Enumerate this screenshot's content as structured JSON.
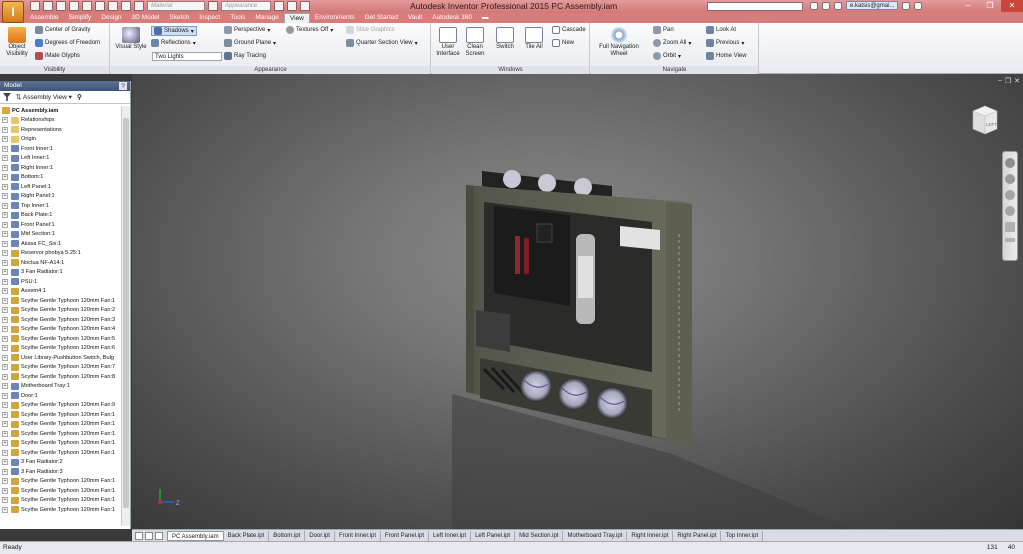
{
  "titlebar": {
    "title": "Autodesk Inventor Professional 2015   PC Assembly.iam",
    "app_button": "I",
    "material_placeholder": "Material",
    "appearance_placeholder": "Appearance",
    "user": "e.katsis@gmai...",
    "search_value": ""
  },
  "ribbon_tabs": [
    "Assemble",
    "Simplify",
    "Design",
    "3D Model",
    "Sketch",
    "Inspect",
    "Tools",
    "Manage",
    "View",
    "Environments",
    "Get Started",
    "Vault",
    "Autodesk 360"
  ],
  "active_tab": "View",
  "ribbon": {
    "visibility": {
      "title": "Visibility",
      "object_visibility": "Object\nVisibility",
      "center_of_gravity": "Center of Gravity",
      "degrees_of_freedom": "Degrees of Freedom",
      "imate_glyphs": "iMate Glyphs"
    },
    "appearance": {
      "title": "Appearance",
      "visual_style": "Visual Style",
      "shadows": "Shadows",
      "reflections": "Reflections",
      "lighting": "Two Lights",
      "perspective": "Perspective",
      "ground_plane": "Ground Plane",
      "ray_tracing": "Ray Tracing",
      "textures": "Textures Off",
      "slice_graphics": "Slice Graphics",
      "quarter_section": "Quarter Section View"
    },
    "windows": {
      "title": "Windows",
      "user_interface": "User\nInterface",
      "clean_screen": "Clean\nScreen",
      "switch": "Switch",
      "tile_all": "Tile All",
      "cascade": "Cascade",
      "new": "New"
    },
    "navigate": {
      "title": "Navigate",
      "full_navigation_wheel": "Full Navigation\nWheel",
      "pan": "Pan",
      "zoom_all": "Zoom All",
      "orbit": "Orbit",
      "look_at": "Look At",
      "previous": "Previous",
      "home_view": "Home View"
    }
  },
  "browser": {
    "header": "Model",
    "help": "?",
    "view_label": "Assembly View",
    "items": [
      {
        "label": "PC Assembly.iam",
        "icon": "assembly-icon",
        "root": true
      },
      {
        "label": "Relationships",
        "icon": "folder-icon"
      },
      {
        "label": "Representations",
        "icon": "folder-icon"
      },
      {
        "label": "Origin",
        "icon": "folder-icon"
      },
      {
        "label": "Front Inner:1",
        "icon": "part-icon"
      },
      {
        "label": "Left Inner:1",
        "icon": "part-icon"
      },
      {
        "label": "Right Inner:1",
        "icon": "part-icon"
      },
      {
        "label": "Bottom:1",
        "icon": "part-icon"
      },
      {
        "label": "Left Panel:1",
        "icon": "part-icon"
      },
      {
        "label": "Right Panel:1",
        "icon": "part-icon"
      },
      {
        "label": "Top Inner:1",
        "icon": "part-icon"
      },
      {
        "label": "Back Plate:1",
        "icon": "part-icon"
      },
      {
        "label": "Front Panel:1",
        "icon": "part-icon"
      },
      {
        "label": "Mid Section:1",
        "icon": "part-icon"
      },
      {
        "label": "Akasa FC_Six:1",
        "icon": "part-icon"
      },
      {
        "label": "Reservor phobya 5.25:1",
        "icon": "subassembly-icon"
      },
      {
        "label": "Noctua NF-A14:1",
        "icon": "subassembly-icon"
      },
      {
        "label": "3 Fan Radiator:1",
        "icon": "part-icon"
      },
      {
        "label": "PSU:1",
        "icon": "part-icon"
      },
      {
        "label": "Assem4:1",
        "icon": "subassembly-icon"
      },
      {
        "label": "Scythe Gentle Typhoon 120mm Fan:1",
        "icon": "subassembly-icon"
      },
      {
        "label": "Scythe Gentle Typhoon 120mm Fan:2",
        "icon": "subassembly-icon"
      },
      {
        "label": "Scythe Gentle Typhoon 120mm Fan:3",
        "icon": "subassembly-icon"
      },
      {
        "label": "Scythe Gentle Typhoon 120mm Fan:4",
        "icon": "subassembly-icon"
      },
      {
        "label": "Scythe Gentle Typhoon 120mm Fan:5",
        "icon": "subassembly-icon"
      },
      {
        "label": "Scythe Gentle Typhoon 120mm Fan:6",
        "icon": "subassembly-icon"
      },
      {
        "label": "User Library-Pushbutton Switch, Bulg",
        "icon": "subassembly-icon"
      },
      {
        "label": "Scythe Gentle Typhoon 120mm Fan:7",
        "icon": "subassembly-icon"
      },
      {
        "label": "Scythe Gentle Typhoon 120mm Fan:8",
        "icon": "subassembly-icon"
      },
      {
        "label": "Motherboard Tray:1",
        "icon": "part-icon"
      },
      {
        "label": "Door:1",
        "icon": "part-icon"
      },
      {
        "label": "Scythe Gentle Typhoon 120mm Fan:9",
        "icon": "subassembly-icon"
      },
      {
        "label": "Scythe Gentle Typhoon 120mm Fan:1",
        "icon": "subassembly-icon"
      },
      {
        "label": "Scythe Gentle Typhoon 120mm Fan:1",
        "icon": "subassembly-icon"
      },
      {
        "label": "Scythe Gentle Typhoon 120mm Fan:1",
        "icon": "subassembly-icon"
      },
      {
        "label": "Scythe Gentle Typhoon 120mm Fan:1",
        "icon": "subassembly-icon"
      },
      {
        "label": "Scythe Gentle Typhoon 120mm Fan:1",
        "icon": "subassembly-icon"
      },
      {
        "label": "3 Fan Radiator:2",
        "icon": "part-icon"
      },
      {
        "label": "3 Fan Radiator:3",
        "icon": "part-icon"
      },
      {
        "label": "Scythe Gentle Typhoon 120mm Fan:1",
        "icon": "subassembly-icon"
      },
      {
        "label": "Scythe Gentle Typhoon 120mm Fan:1",
        "icon": "subassembly-icon"
      },
      {
        "label": "Scythe Gentle Typhoon 120mm Fan:1",
        "icon": "subassembly-icon"
      },
      {
        "label": "Scythe Gentle Typhoon 120mm Fan:1",
        "icon": "subassembly-icon"
      }
    ]
  },
  "viewcube_label": "LEFT",
  "triad": {
    "y": "Y",
    "z": "Z"
  },
  "doc_tabs": [
    "PC Assembly.iam",
    "Back Plate.ipt",
    "Bottom.ipt",
    "Door.ipt",
    "Front Inner.ipt",
    "Front Panel.ipt",
    "Left Inner.ipt",
    "Left Panel.ipt",
    "Mid Section.ipt",
    "Motherboard Tray.ipt",
    "Right Inner.ipt",
    "Right Panel.ipt",
    "Top Inner.ipt"
  ],
  "active_doc_tab": "PC Assembly.iam",
  "status": {
    "text": "Ready",
    "count1": "131",
    "count2": "40"
  },
  "colors": {
    "titlebar": "#d27878",
    "accent": "#41557a",
    "viewport": "#6e6e6e"
  }
}
